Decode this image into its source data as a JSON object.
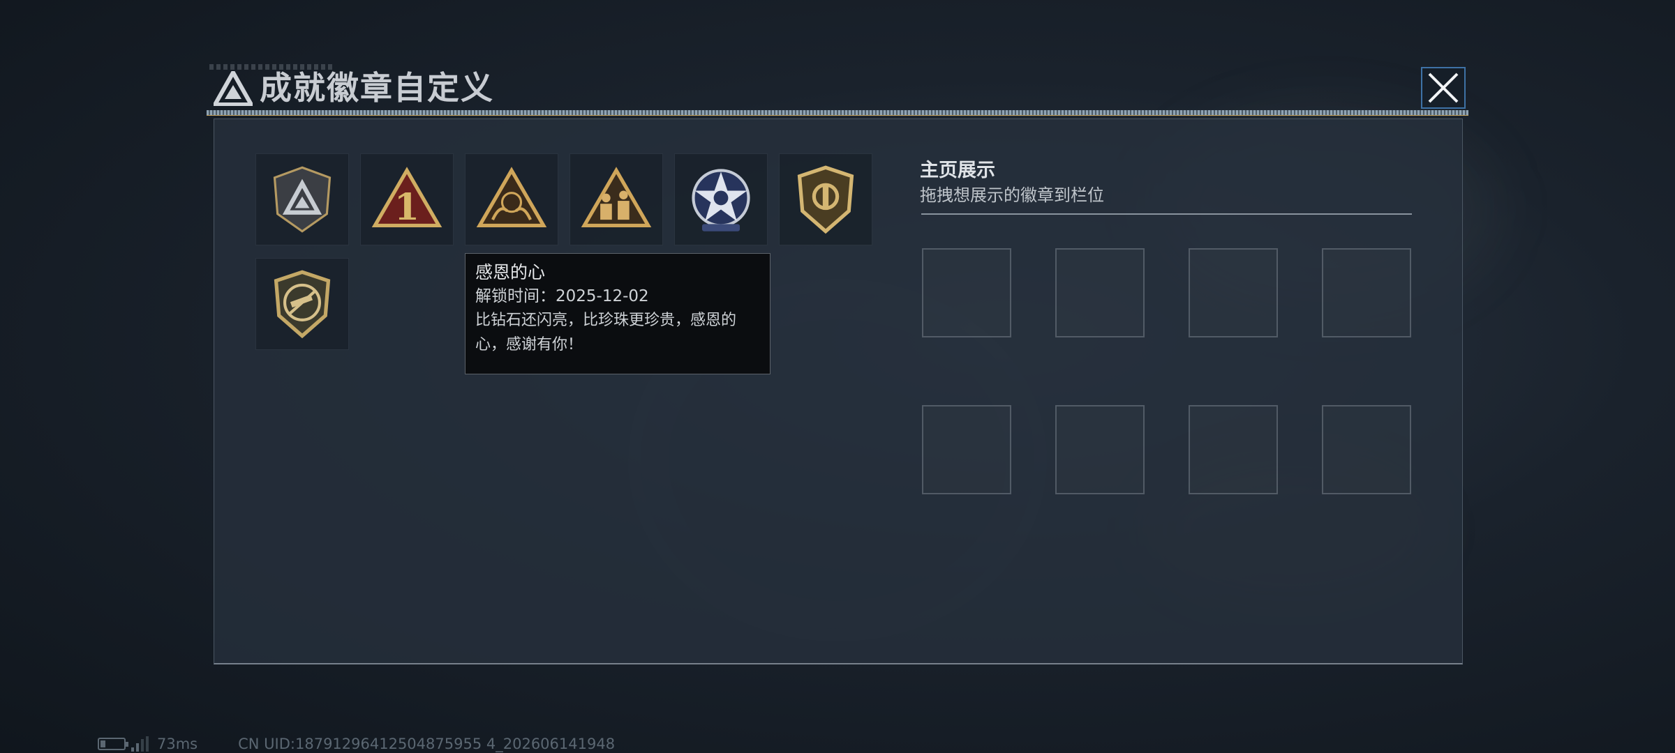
{
  "dialog": {
    "title": "成就徽章自定义",
    "close_icon": "close-icon"
  },
  "badges": [
    {
      "name": "shield-triangle-badge",
      "icon": "triangle-shield-icon"
    },
    {
      "name": "rank-one-badge",
      "icon": "number-one-triangle-icon"
    },
    {
      "name": "grateful-heart-badge",
      "icon": "hands-triangle-icon"
    },
    {
      "name": "squad-badge",
      "icon": "soldiers-triangle-icon"
    },
    {
      "name": "star-medal-badge",
      "icon": "star-medal-icon"
    },
    {
      "name": "gold-shield-badge",
      "icon": "gold-shield-icon"
    },
    {
      "name": "no-rifle-badge",
      "icon": "crossed-rifle-shield-icon"
    }
  ],
  "tooltip": {
    "title": "感恩的心",
    "unlock_label": "解锁时间：2025-12-02",
    "description_line1": "比钻石还闪亮，比珍珠更珍贵，感恩的",
    "description_line2": "心，感谢有你！"
  },
  "showcase": {
    "title": "主页展示",
    "subtitle": "拖拽想展示的徽章到栏位",
    "slot_count": 8
  },
  "status": {
    "battery_level": 0.2,
    "signal_bars": 2,
    "ping": "73ms",
    "uid": "CN UID:18791296412504875955 4_202606141948"
  },
  "colors": {
    "panel_bg": "#26303c",
    "gold": "#c9a85c",
    "close_border": "#5096dc"
  }
}
